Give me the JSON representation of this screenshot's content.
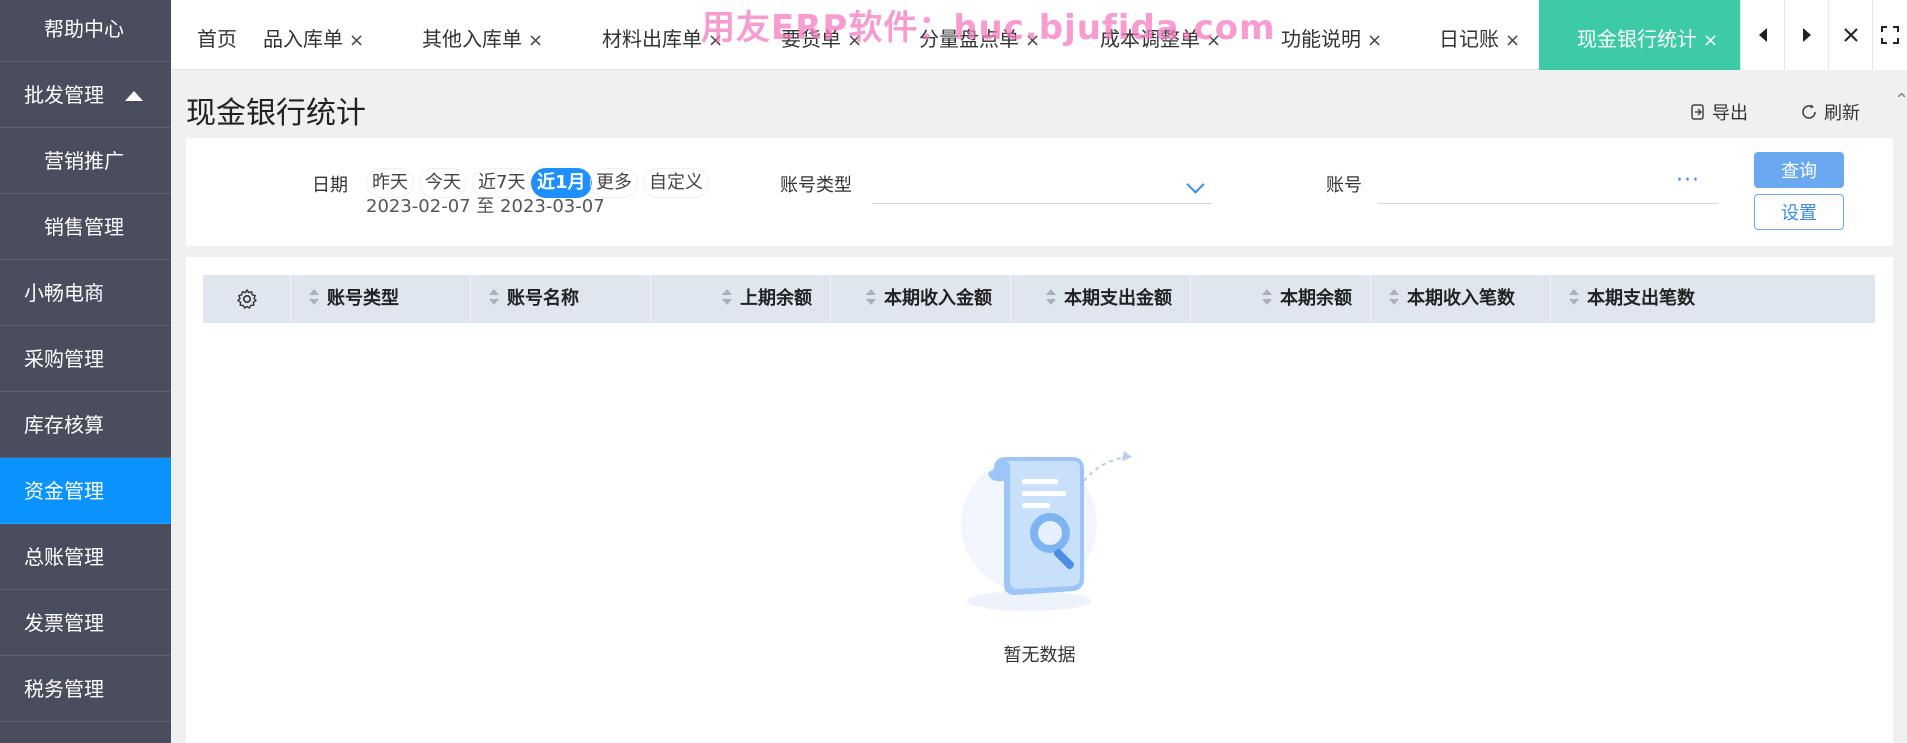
{
  "sidebar": {
    "items": [
      {
        "label": "帮助中心"
      },
      {
        "label": "批发管理"
      },
      {
        "label": "营销推广"
      },
      {
        "label": "销售管理"
      },
      {
        "label": "小畅电商"
      },
      {
        "label": "采购管理"
      },
      {
        "label": "库存核算"
      },
      {
        "label": "资金管理"
      },
      {
        "label": "总账管理"
      },
      {
        "label": "发票管理"
      },
      {
        "label": "税务管理"
      }
    ]
  },
  "tabs": [
    {
      "label": "首页"
    },
    {
      "label": "品入库单"
    },
    {
      "label": "其他入库单"
    },
    {
      "label": "材料出库单"
    },
    {
      "label": "要货单"
    },
    {
      "label": "分量盘点单"
    },
    {
      "label": "成本调整单"
    },
    {
      "label": "功能说明"
    },
    {
      "label": "日记账"
    },
    {
      "label": "现金银行统计"
    }
  ],
  "tab_close_glyph": "×",
  "watermark": "用友ERP软件：huc.bjufida.com",
  "page": {
    "title": "现金银行统计",
    "export_label": "导出",
    "refresh_label": "刷新"
  },
  "filter": {
    "date_label": "日期",
    "date_chips": [
      "昨天",
      "今天",
      "近7天",
      "近1月",
      "更多",
      "自定义"
    ],
    "selected_chip": "近1月",
    "date_range": "2023-02-07 至 2023-03-07",
    "account_type_label": "账号类型",
    "account_type_value": "",
    "account_label": "账号",
    "account_value": "",
    "account_more": "···",
    "query_label": "查询",
    "settings_label": "设置"
  },
  "table": {
    "columns": [
      "账号类型",
      "账号名称",
      "上期余额",
      "本期收入金额",
      "本期支出金额",
      "本期余额",
      "本期收入笔数",
      "本期支出笔数"
    ],
    "rows": [],
    "empty_text": "暂无数据"
  },
  "colors": {
    "sidebar_bg": "#4a4d5e",
    "sidebar_active": "#0a93ff",
    "active_tab": "#3ccba6",
    "primary": "#1e8fff",
    "table_header": "#dfe6ef",
    "watermark": "#f47ac0"
  }
}
